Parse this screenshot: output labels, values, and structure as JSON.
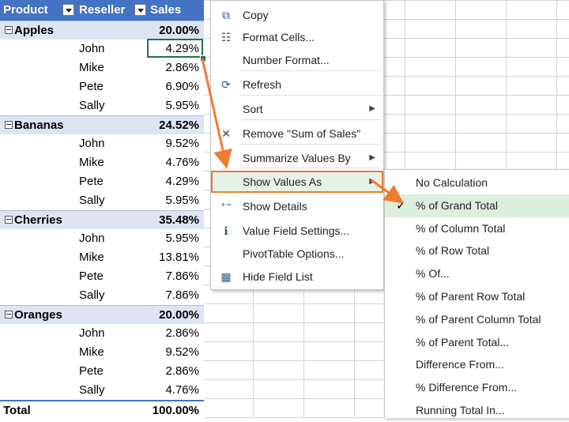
{
  "pivot": {
    "headers": {
      "product": "Product",
      "reseller": "Reseller",
      "sales": "Sales"
    },
    "rows": [
      {
        "type": "group",
        "label": "Apples",
        "value": "20.00%"
      },
      {
        "type": "item",
        "label": "John",
        "value": "4.29%"
      },
      {
        "type": "item",
        "label": "Mike",
        "value": "2.86%"
      },
      {
        "type": "item",
        "label": "Pete",
        "value": "6.90%"
      },
      {
        "type": "item",
        "label": "Sally",
        "value": "5.95%"
      },
      {
        "type": "group",
        "label": "Bananas",
        "value": "24.52%"
      },
      {
        "type": "item",
        "label": "John",
        "value": "9.52%"
      },
      {
        "type": "item",
        "label": "Mike",
        "value": "4.76%"
      },
      {
        "type": "item",
        "label": "Pete",
        "value": "4.29%"
      },
      {
        "type": "item",
        "label": "Sally",
        "value": "5.95%"
      },
      {
        "type": "group",
        "label": "Cherries",
        "value": "35.48%"
      },
      {
        "type": "item",
        "label": "John",
        "value": "5.95%"
      },
      {
        "type": "item",
        "label": "Mike",
        "value": "13.81%"
      },
      {
        "type": "item",
        "label": "Pete",
        "value": "7.86%"
      },
      {
        "type": "item",
        "label": "Sally",
        "value": "7.86%"
      },
      {
        "type": "group",
        "label": "Oranges",
        "value": "20.00%"
      },
      {
        "type": "item",
        "label": "John",
        "value": "2.86%"
      },
      {
        "type": "item",
        "label": "Mike",
        "value": "9.52%"
      },
      {
        "type": "item",
        "label": "Pete",
        "value": "2.86%"
      },
      {
        "type": "item",
        "label": "Sally",
        "value": "4.76%"
      },
      {
        "type": "total",
        "label": "Total",
        "value": "100.00%"
      }
    ]
  },
  "context_menu": {
    "items": [
      {
        "label": "Copy",
        "icon": "copy-icon",
        "glyph": "⧉"
      },
      {
        "label": "Format Cells...",
        "icon": "format-cells-icon",
        "glyph": "☷"
      },
      {
        "label": "Number Format...",
        "icon": "",
        "glyph": ""
      },
      {
        "label": "Refresh",
        "icon": "refresh-icon",
        "glyph": "⟳"
      },
      {
        "label": "Sort",
        "icon": "",
        "glyph": "",
        "submenu": true
      },
      {
        "label": "Remove \"Sum of  Sales\"",
        "icon": "remove-x-icon",
        "glyph": "✕"
      },
      {
        "label": "Summarize Values By",
        "icon": "",
        "glyph": "",
        "submenu": true
      },
      {
        "label": "Show Values As",
        "icon": "",
        "glyph": "",
        "submenu": true,
        "highlighted": true
      },
      {
        "label": "Show Details",
        "icon": "show-details-icon",
        "glyph": "⁺⁼"
      },
      {
        "label": "Value Field Settings...",
        "icon": "value-field-settings-icon",
        "glyph": "ℹ"
      },
      {
        "label": "PivotTable Options...",
        "icon": "",
        "glyph": ""
      },
      {
        "label": "Hide Field List",
        "icon": "field-list-icon",
        "glyph": "▦"
      }
    ]
  },
  "submenu": {
    "items": [
      {
        "label": "No Calculation"
      },
      {
        "label": "% of Grand Total",
        "checked": true
      },
      {
        "label": "% of Column Total"
      },
      {
        "label": "% of Row Total"
      },
      {
        "label": "% Of..."
      },
      {
        "label": "% of Parent Row Total"
      },
      {
        "label": "% of Parent Column Total"
      },
      {
        "label": "% of Parent Total..."
      },
      {
        "label": "Difference From..."
      },
      {
        "label": "% Difference From..."
      },
      {
        "label": "Running Total In..."
      }
    ]
  },
  "colors": {
    "header_blue": "#4472c4",
    "group_row": "#dde5f3",
    "selection_green": "#217346",
    "annotation_orange": "#ed7d31"
  }
}
